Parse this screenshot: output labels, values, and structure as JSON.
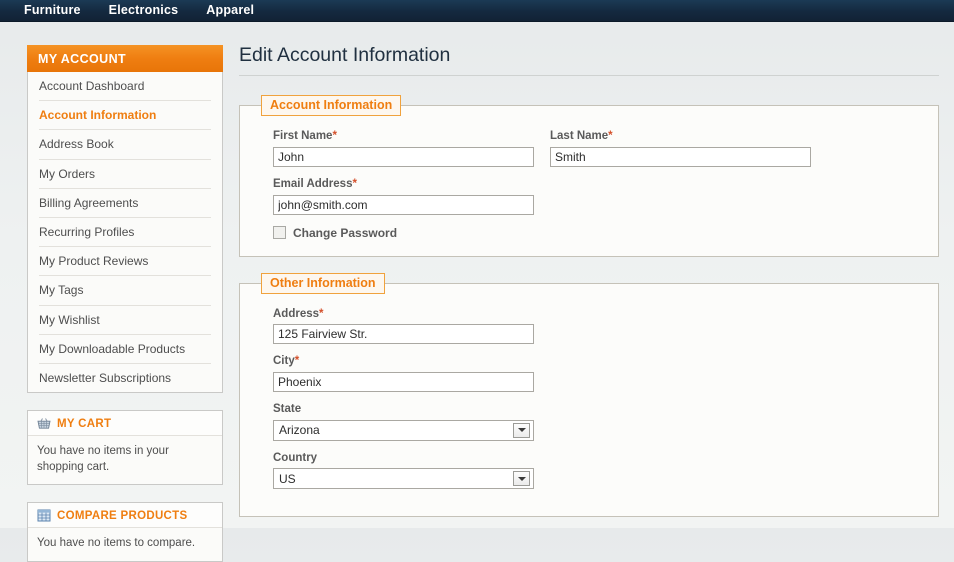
{
  "topnav": {
    "items": [
      {
        "label": "Furniture"
      },
      {
        "label": "Electronics"
      },
      {
        "label": "Apparel"
      }
    ]
  },
  "sidebar": {
    "account_block": {
      "title": "MY ACCOUNT",
      "items": [
        {
          "label": "Account Dashboard",
          "current": false
        },
        {
          "label": "Account Information",
          "current": true
        },
        {
          "label": "Address Book",
          "current": false
        },
        {
          "label": "My Orders",
          "current": false
        },
        {
          "label": "Billing Agreements",
          "current": false
        },
        {
          "label": "Recurring Profiles",
          "current": false
        },
        {
          "label": "My Product Reviews",
          "current": false
        },
        {
          "label": "My Tags",
          "current": false
        },
        {
          "label": "My Wishlist",
          "current": false
        },
        {
          "label": "My Downloadable Products",
          "current": false
        },
        {
          "label": "Newsletter Subscriptions",
          "current": false
        }
      ]
    },
    "cart_block": {
      "icon": "shopping-basket-icon",
      "title": "MY CART",
      "message": "You have no items in your shopping cart."
    },
    "compare_block": {
      "icon": "compare-grid-icon",
      "title": "COMPARE PRODUCTS",
      "message": "You have no items to compare."
    }
  },
  "main": {
    "page_title": "Edit Account Information",
    "account_fieldset": {
      "legend": "Account Information",
      "first_name": {
        "label": "First Name",
        "required": "*",
        "value": "John",
        "placeholder": ""
      },
      "last_name": {
        "label": "Last Name",
        "required": "*",
        "value": "Smith",
        "placeholder": ""
      },
      "email": {
        "label": "Email Address",
        "required": "*",
        "value": "john@smith.com",
        "placeholder": ""
      },
      "change_password": {
        "label": "Change Password",
        "checked": false
      }
    },
    "other_fieldset": {
      "legend": "Other Information",
      "address": {
        "label": "Address",
        "required": "*",
        "value": "125 Fairview Str.",
        "placeholder": ""
      },
      "city": {
        "label": "City",
        "required": "*",
        "value": "Phoenix",
        "placeholder": ""
      },
      "state": {
        "label": "State",
        "required": "",
        "value": "Arizona"
      },
      "country": {
        "label": "Country",
        "required": "",
        "value": "US"
      }
    }
  },
  "colors": {
    "nav_bg": "#14293f",
    "accent_orange": "#ef7e11",
    "required_red": "#d4502b",
    "page_bg": "#eef1f1",
    "fieldset_border": "#c5c2b8"
  }
}
